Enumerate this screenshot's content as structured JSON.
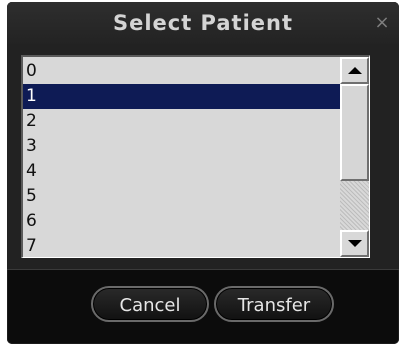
{
  "dialog": {
    "title": "Select Patient",
    "close_glyph": "×"
  },
  "patients": [
    {
      "label": "0",
      "selected": false
    },
    {
      "label": "1",
      "selected": true
    },
    {
      "label": "2",
      "selected": false
    },
    {
      "label": "3",
      "selected": false
    },
    {
      "label": "4",
      "selected": false
    },
    {
      "label": "5",
      "selected": false
    },
    {
      "label": "6",
      "selected": false
    },
    {
      "label": "7",
      "selected": false
    }
  ],
  "buttons": {
    "cancel": "Cancel",
    "transfer": "Transfer"
  },
  "icons": {
    "close": "close-icon",
    "scroll_up": "arrow-up-icon",
    "scroll_down": "arrow-down-icon"
  },
  "colors": {
    "selection": "#0e1b55",
    "dialog_bg": "#0c0c0c",
    "list_bg": "#d8d8d8"
  }
}
